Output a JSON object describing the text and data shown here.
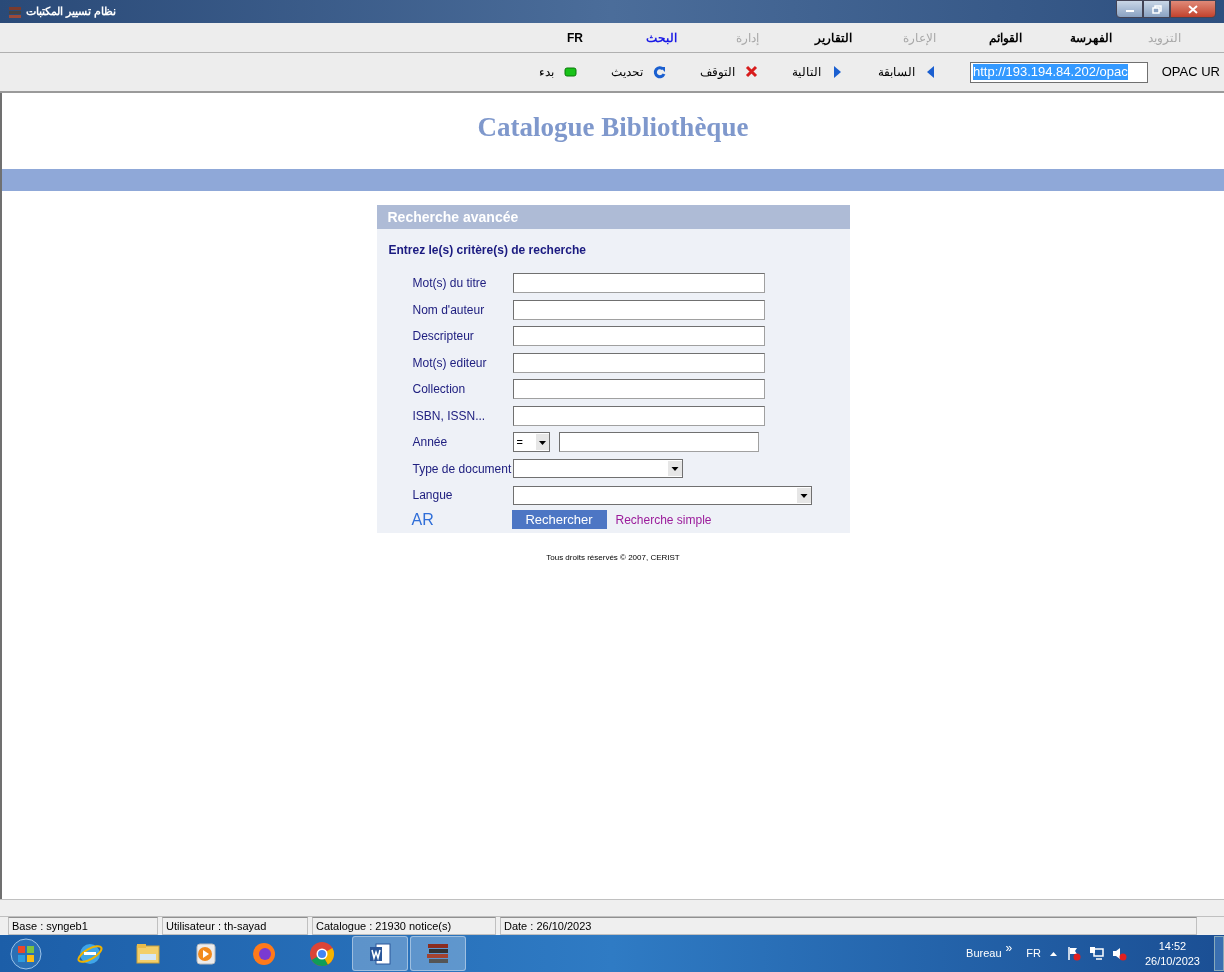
{
  "window": {
    "title": "نظام تسيير المكتبات"
  },
  "menu": [
    {
      "label": "التزويد",
      "disabled": true,
      "selected": false
    },
    {
      "label": "الفهرسة",
      "disabled": false,
      "selected": false
    },
    {
      "label": "القوائم",
      "disabled": false,
      "selected": false
    },
    {
      "label": "الإعارة",
      "disabled": true,
      "selected": false
    },
    {
      "label": "التقارير",
      "disabled": false,
      "selected": false
    },
    {
      "label": "إدارة",
      "disabled": true,
      "selected": false
    },
    {
      "label": "البحث",
      "disabled": false,
      "selected": true
    },
    {
      "label": "FR",
      "disabled": false,
      "selected": false
    }
  ],
  "toolbar": {
    "url_label": "OPAC UR",
    "url": "http://193.194.84.202/opac",
    "buttons": [
      {
        "kind": "back",
        "label": "السابقة"
      },
      {
        "kind": "forward",
        "label": "التالية"
      },
      {
        "kind": "stop",
        "label": "التوقف"
      },
      {
        "kind": "refresh",
        "label": "تحديث"
      },
      {
        "kind": "start",
        "label": "بدء"
      }
    ]
  },
  "page": {
    "title": "Catalogue Bibliothèque",
    "panel_title": "Recherche avancée",
    "instruction": "Entrez le(s) critère(s) de recherche",
    "fields": [
      {
        "label": "Mot(s) du titre",
        "kind": "text"
      },
      {
        "label": "Nom d'auteur",
        "kind": "text"
      },
      {
        "label": "Descripteur",
        "kind": "text"
      },
      {
        "label": "Mot(s) editeur",
        "kind": "text"
      },
      {
        "label": "Collection",
        "kind": "text"
      },
      {
        "label": "ISBN, ISSN...",
        "kind": "text"
      },
      {
        "label": "Année",
        "kind": "year",
        "operator": "="
      },
      {
        "label": "Type de document",
        "kind": "select-short"
      },
      {
        "label": "Langue",
        "kind": "select-long"
      }
    ],
    "language_link": "AR",
    "search_button": "Rechercher",
    "simple_link": "Recherche simple",
    "footer": "Tous droits réservés © 2007, CERIST"
  },
  "status_bar": {
    "database": "Base : syngeb1",
    "user": "Utilisateur : th-sayad",
    "catalogue": "Catalogue : 21930 notice(s)",
    "date": "Date : 26/10/2023"
  },
  "taskbar": {
    "apps": [
      {
        "kind": "ie",
        "active": false
      },
      {
        "kind": "folder",
        "active": false
      },
      {
        "kind": "media",
        "active": false
      },
      {
        "kind": "firefox",
        "active": false
      },
      {
        "kind": "chrome",
        "active": false
      },
      {
        "kind": "word",
        "active": true
      },
      {
        "kind": "books",
        "active": true
      }
    ],
    "toolbar_label": "Bureau",
    "overflow": "»",
    "language": "FR",
    "time": "14:52",
    "date": "26/10/2023"
  }
}
